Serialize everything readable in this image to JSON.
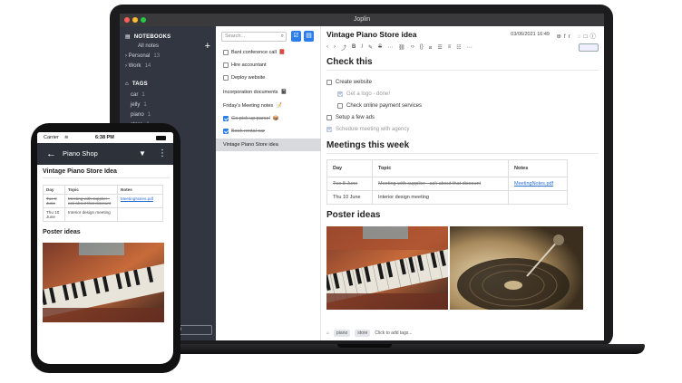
{
  "laptop": {
    "window_title": "Joplin",
    "sidebar": {
      "notebooks_label": "NOTEBOOKS",
      "all_notes": "All notes",
      "notebooks": [
        {
          "name": "Personal",
          "count": "13"
        },
        {
          "name": "Work",
          "count": "14"
        }
      ],
      "tags_label": "TAGS",
      "tags": [
        {
          "name": "car",
          "count": "1"
        },
        {
          "name": "jelly",
          "count": "1"
        },
        {
          "name": "piano",
          "count": "1"
        },
        {
          "name": "store",
          "count": "1"
        }
      ],
      "sync_label": "e"
    },
    "note_list": {
      "search_placeholder": "Search...",
      "notes": [
        {
          "title": "Bant conference call",
          "checkbox": "empty",
          "emoji": "📕"
        },
        {
          "title": "Hire accountant",
          "checkbox": "empty",
          "emoji": ""
        },
        {
          "title": "Deploy website",
          "checkbox": "empty",
          "emoji": ""
        },
        {
          "title": "Incorporation documents",
          "checkbox": "none",
          "emoji": "📓"
        },
        {
          "title": "Friday's Meeting notes",
          "checkbox": "none",
          "emoji": "📝"
        },
        {
          "title": "Go pick up parcel",
          "checkbox": "checked",
          "emoji": "📦"
        },
        {
          "title": "Book rental car",
          "checkbox": "checked",
          "emoji": ""
        },
        {
          "title": "Vintage Piano Store idea",
          "checkbox": "none",
          "emoji": "",
          "selected": true
        }
      ]
    },
    "editor": {
      "title": "Vintage Piano Store idea",
      "date": "03/06/2021 16:49",
      "lang": "fr",
      "heading1": "Check this",
      "todos": [
        {
          "text": "Create website",
          "done": false,
          "indent": 0
        },
        {
          "text": "Get a logo - done!",
          "done": true,
          "indent": 1
        },
        {
          "text": "Check online payment services",
          "done": false,
          "indent": 1
        },
        {
          "text": "Setup a few ads",
          "done": false,
          "indent": 0
        },
        {
          "text": "Schedule meeting with agency",
          "done": true,
          "indent": 0
        }
      ],
      "heading2": "Meetings this week",
      "table": {
        "headers": [
          "Day",
          "Topic",
          "Notes"
        ],
        "rows": [
          {
            "day": "Tue 8 June",
            "topic": "Meeting with supplier - ask about that discount",
            "notes": "MeetingNotes.pdf",
            "struck": true
          },
          {
            "day": "Thu 10 June",
            "topic": "Interior design meeting",
            "notes": "",
            "struck": false
          }
        ]
      },
      "heading3": "Poster ideas",
      "footer_tags": [
        "piano",
        "store"
      ],
      "footer_add": "Click to add tags..."
    }
  },
  "phone": {
    "carrier": "Carrier",
    "time": "6:38 PM",
    "notebook_title": "Piano Shop",
    "note_title": "Vintage Piano Store Idea",
    "table": {
      "headers": [
        "Day",
        "Topic",
        "Notes"
      ],
      "rows": [
        {
          "day": "Tue 8 June",
          "topic": "Meeting with supplier - ask about that discount",
          "notes": "MeetingNotes.pdf",
          "struck": true
        },
        {
          "day": "Thu 10 June",
          "topic": "Interior design meeting",
          "notes": "",
          "struck": false
        }
      ]
    },
    "poster_heading": "Poster ideas"
  },
  "colors": {
    "accent": "#2b7de9",
    "sidebar_bg": "#313640",
    "titlebar_bg": "#3a3a3c"
  }
}
